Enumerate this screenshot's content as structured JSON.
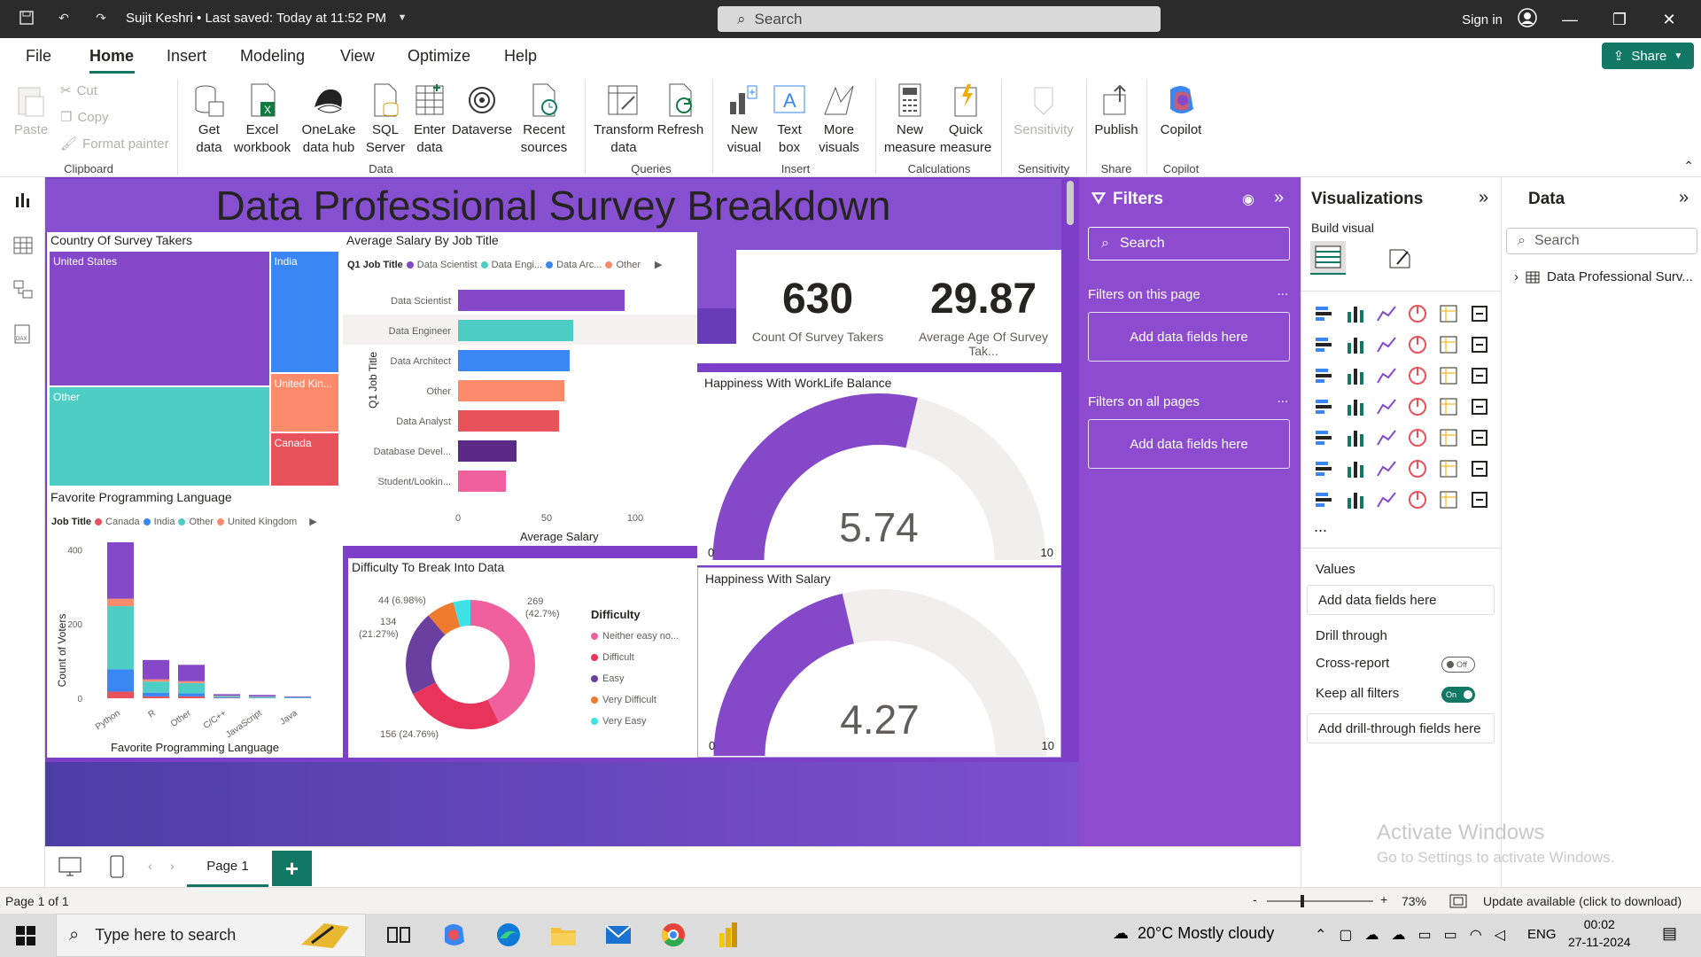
{
  "titlebar": {
    "user_file": "Sujit Keshri • Last saved: Today at 11:52 PM",
    "search": "Search",
    "signin": "Sign in"
  },
  "menu": {
    "items": [
      "File",
      "Home",
      "Insert",
      "Modeling",
      "View",
      "Optimize",
      "Help"
    ],
    "share": "Share"
  },
  "ribbon": {
    "clipboard": {
      "paste": "Paste",
      "cut": "Cut",
      "copy": "Copy",
      "format_painter": "Format painter",
      "group": "Clipboard"
    },
    "data": {
      "get_data": "Get data",
      "excel": "Excel workbook",
      "onelake": "OneLake data hub",
      "sql": "SQL Server",
      "enter": "Enter data",
      "dataverse": "Dataverse",
      "recent": "Recent sources",
      "group": "Data"
    },
    "queries": {
      "transform": "Transform data",
      "refresh": "Refresh",
      "group": "Queries"
    },
    "insert": {
      "new_visual": "New visual",
      "text_box": "Text box",
      "more_visuals": "More visuals",
      "group": "Insert"
    },
    "calculations": {
      "new_measure": "New measure",
      "quick_measure": "Quick measure",
      "group": "Calculations"
    },
    "sensitivity": {
      "label": "Sensitivity",
      "group": "Sensitivity"
    },
    "share": {
      "publish": "Publish",
      "group": "Share"
    },
    "copilot": {
      "label": "Copilot",
      "group": "Copilot"
    }
  },
  "dashboard": {
    "title": "Data Professional Survey Breakdown",
    "treemap": {
      "title": "Country Of Survey Takers",
      "cells": [
        {
          "label": "United States",
          "color": "#8548c8"
        },
        {
          "label": "India",
          "color": "#3a86f5"
        },
        {
          "label": "Other",
          "color": "#4ecdc4"
        },
        {
          "label": "United Kin...",
          "color": "#fb8b6b"
        },
        {
          "label": "Canada",
          "color": "#e8525a"
        }
      ]
    },
    "salary": {
      "title": "Average Salary By Job Title",
      "legend_title": "Q1 Job Title",
      "legend": [
        {
          "label": "Data Scientist",
          "color": "#8548c8"
        },
        {
          "label": "Data Engi...",
          "color": "#4ecdc4"
        },
        {
          "label": "Data Arc...",
          "color": "#3a86f5"
        },
        {
          "label": "Other",
          "color": "#fb8b6b"
        }
      ],
      "ylabel": "Q1 Job Title",
      "xlabel": "Average Salary",
      "xticks": [
        "0",
        "50",
        "100"
      ]
    },
    "kpi1": {
      "value": "630",
      "label": "Count Of Survey Takers"
    },
    "kpi2": {
      "value": "29.87",
      "label": "Average Age Of Survey Tak..."
    },
    "gauge1": {
      "title": "Happiness With WorkLife Balance",
      "value": "5.74",
      "min": "0",
      "max": "10",
      "fraction": 0.574
    },
    "gauge2": {
      "title": "Happiness With Salary",
      "value": "4.27",
      "min": "0",
      "max": "10",
      "fraction": 0.427
    },
    "fav_lang": {
      "title": "Favorite Programming Language",
      "legend_title": "Job Title",
      "legend": [
        {
          "label": "Canada",
          "color": "#e8525a"
        },
        {
          "label": "India",
          "color": "#3a86f5"
        },
        {
          "label": "Other",
          "color": "#4ecdc4"
        },
        {
          "label": "United Kingdom",
          "color": "#fb8b6b"
        }
      ],
      "ylabel": "Count of Voters",
      "xlabel": "Favorite Programming Language",
      "yticks": [
        "400",
        "200",
        "0"
      ]
    },
    "difficulty": {
      "title": "Difficulty To Break Into Data",
      "legend_title": "Difficulty",
      "legend": [
        {
          "label": "Neither easy no...",
          "color": "#f0609e"
        },
        {
          "label": "Difficult",
          "color": "#e8335a"
        },
        {
          "label": "Easy",
          "color": "#6b3fa0"
        },
        {
          "label": "Very Difficult",
          "color": "#f07a2e"
        },
        {
          "label": "Very Easy",
          "color": "#3de1e6"
        }
      ],
      "labels": [
        "44 (6.98%)",
        "134",
        "(21.27%)",
        "269",
        "(42.7%)",
        "156 (24.76%)"
      ]
    }
  },
  "chart_data": [
    {
      "type": "treemap",
      "title": "Country Of Survey Takers",
      "categories": [
        "United States",
        "India",
        "Other",
        "United Kin...",
        "Canada"
      ],
      "values": [
        262,
        74,
        193,
        36,
        33
      ]
    },
    {
      "type": "bar",
      "title": "Average Salary By Job Title",
      "categories": [
        "Data Scientist",
        "Data Engineer",
        "Data Architect",
        "Other",
        "Data Analyst",
        "Database Devel...",
        "Student/Lookin..."
      ],
      "values": [
        94,
        65,
        63,
        60,
        57,
        33,
        27
      ],
      "xlabel": "Average Salary",
      "ylabel": "Q1 Job Title",
      "xlim": [
        0,
        100
      ]
    },
    {
      "type": "bar",
      "stacked": true,
      "title": "Favorite Programming Language",
      "categories": [
        "Python",
        "R",
        "Other",
        "C/C++",
        "JavaScript",
        "Java"
      ],
      "series": [
        {
          "name": "Canada",
          "values": [
            18,
            5,
            5,
            1,
            0,
            0
          ]
        },
        {
          "name": "India",
          "values": [
            60,
            10,
            8,
            2,
            1,
            1
          ]
        },
        {
          "name": "Other",
          "values": [
            170,
            30,
            28,
            3,
            3,
            2
          ]
        },
        {
          "name": "United Kingdom",
          "values": [
            20,
            6,
            5,
            1,
            1,
            0
          ]
        },
        {
          "name": "United States",
          "values": [
            152,
            52,
            44,
            4,
            4,
            2
          ]
        }
      ],
      "xlabel": "Favorite Programming Language",
      "ylabel": "Count of Voters",
      "ylim": [
        0,
        420
      ]
    },
    {
      "type": "pie",
      "donut": true,
      "title": "Difficulty To Break Into Data",
      "categories": [
        "Neither easy no...",
        "Difficult",
        "Easy",
        "Very Difficult",
        "Very Easy"
      ],
      "values": [
        269,
        156,
        134,
        44,
        27
      ]
    },
    {
      "type": "gauge",
      "title": "Happiness With WorkLife Balance",
      "values": [
        5.74
      ],
      "ylim": [
        0,
        10
      ]
    },
    {
      "type": "gauge",
      "title": "Happiness With Salary",
      "values": [
        4.27
      ],
      "ylim": [
        0,
        10
      ]
    }
  ],
  "filters": {
    "title": "Filters",
    "search": "Search",
    "on_page": "Filters on this page",
    "on_all": "Filters on all pages",
    "add": "Add data fields here",
    "dots": "..."
  },
  "viz": {
    "title": "Visualizations",
    "build": "Build visual",
    "values": "Values",
    "add": "Add data fields here",
    "drill": "Drill through",
    "cross": "Cross-report",
    "keep": "Keep all filters",
    "off": "Off",
    "on": "On",
    "add_drill": "Add drill-through fields here",
    "more": "..."
  },
  "data_pane": {
    "title": "Data",
    "search": "Search",
    "table": "Data Professional Surv..."
  },
  "pages": {
    "page1": "Page 1",
    "add": "+"
  },
  "status": {
    "page": "Page 1 of 1",
    "zoom": "73%",
    "update": "Update available (click to download)"
  },
  "activate": {
    "title": "Activate Windows",
    "sub": "Go to Settings to activate Windows."
  },
  "taskbar": {
    "search": "Type here to search",
    "weather": "20°C  Mostly cloudy",
    "lang": "ENG",
    "time": "00:02",
    "date": "27-11-2024"
  }
}
